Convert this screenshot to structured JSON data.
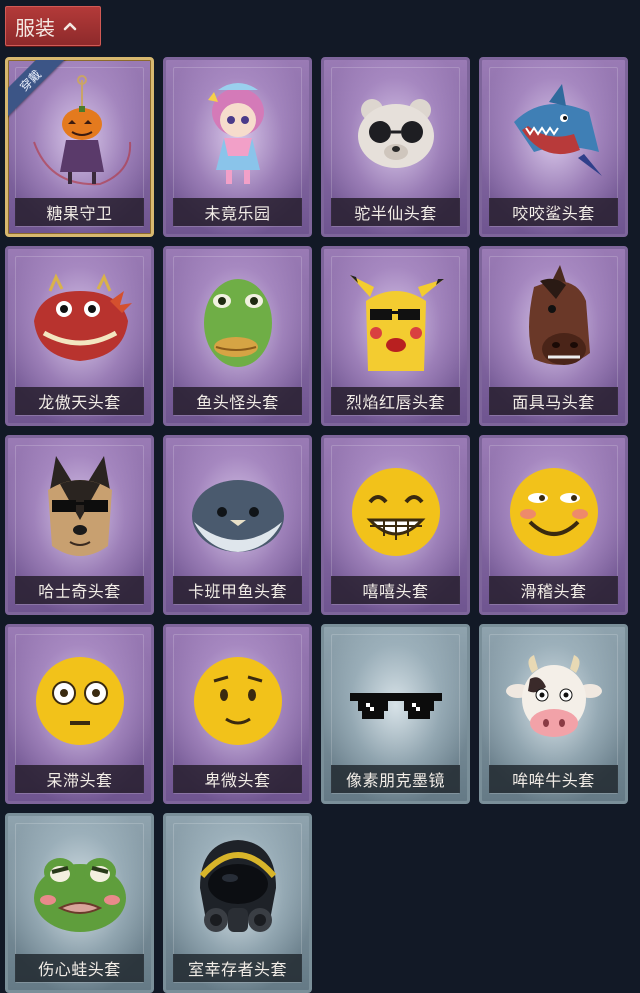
{
  "header": {
    "title": "服装",
    "toggle_icon": "chevron-up-icon"
  },
  "badge": {
    "equipped": "穿戴"
  },
  "items": [
    {
      "label": "糖果守卫",
      "style": "purple",
      "icon": "pumpkin-charm-icon",
      "selected": true
    },
    {
      "label": "未竟乐园",
      "style": "purple",
      "icon": "doll-figure-icon"
    },
    {
      "label": "驼半仙头套",
      "style": "purple",
      "icon": "bear-head-icon"
    },
    {
      "label": "咬咬鲨头套",
      "style": "purple",
      "icon": "shark-head-icon"
    },
    {
      "label": "龙傲天头套",
      "style": "purple",
      "icon": "dragon-head-icon"
    },
    {
      "label": "鱼头怪头套",
      "style": "purple",
      "icon": "fish-head-icon"
    },
    {
      "label": "烈焰红唇头套",
      "style": "purple",
      "icon": "yellow-mask-icon"
    },
    {
      "label": "面具马头套",
      "style": "purple",
      "icon": "horse-head-icon"
    },
    {
      "label": "哈士奇头套",
      "style": "purple",
      "icon": "husky-head-icon"
    },
    {
      "label": "卡班甲鱼头套",
      "style": "purple",
      "icon": "turtle-head-icon"
    },
    {
      "label": "嘻嘻头套",
      "style": "purple",
      "icon": "grin-emoji-icon"
    },
    {
      "label": "滑稽头套",
      "style": "purple",
      "icon": "smirk-emoji-icon"
    },
    {
      "label": "呆滞头套",
      "style": "purple",
      "icon": "dazed-emoji-icon"
    },
    {
      "label": "卑微头套",
      "style": "purple",
      "icon": "humble-emoji-icon"
    },
    {
      "label": "像素朋克墨镜",
      "style": "blue",
      "icon": "pixel-sunglasses-icon"
    },
    {
      "label": "哞哞牛头套",
      "style": "blue",
      "icon": "cow-head-icon"
    },
    {
      "label": "伤心蛙头套",
      "style": "blue",
      "icon": "sad-frog-icon"
    },
    {
      "label": "室幸存者头套",
      "style": "blue",
      "icon": "gas-mask-helmet-icon"
    }
  ],
  "colors": {
    "background": "#121926",
    "header": "#a23534",
    "card_purple": "#8a6aa8",
    "card_blue": "#7d919c",
    "selected_border": "#d7b86f",
    "ribbon": "#3c5586"
  }
}
